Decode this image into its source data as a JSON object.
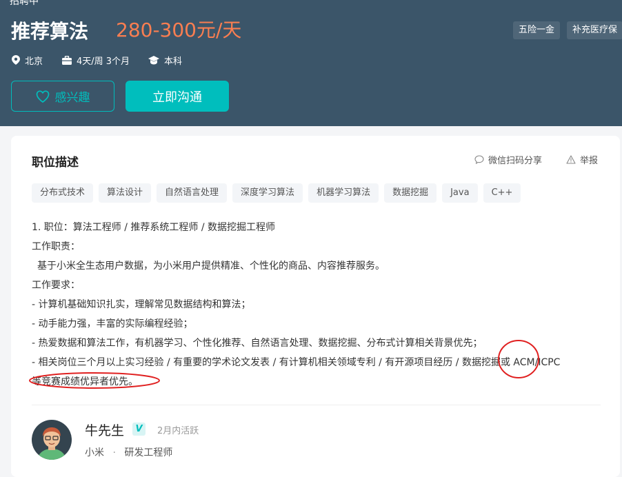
{
  "header": {
    "cut_text": "招聘中",
    "title": "推荐算法",
    "salary": "280-300元/天",
    "benefits": [
      "五险一金",
      "补充医疗保"
    ],
    "meta": {
      "location": "北京",
      "schedule": "4天/周 3个月",
      "degree": "本科"
    },
    "buttons": {
      "like": "感兴趣",
      "chat": "立即沟通"
    }
  },
  "card": {
    "title": "职位描述",
    "share": "微信扫码分享",
    "report": "举报",
    "tags": [
      "分布式技术",
      "算法设计",
      "自然语言处理",
      "深度学习算法",
      "机器学习算法",
      "数据挖掘",
      "Java",
      "C++"
    ],
    "description": [
      "1. 职位：算法工程师 / 推荐系统工程师 / 数据挖掘工程师",
      "工作职责：",
      "基于小米全生态用户数据，为小米用户提供精准、个性化的商品、内容推荐服务。",
      "工作要求：",
      "- 计算机基础知识扎实，理解常见数据结构和算法；",
      "- 动手能力强，丰富的实际编程经验；",
      "- 热爱数据和算法工作，有机器学习、个性化推荐、自然语言处理、数据挖掘、分布式计算相关背景优先；",
      "- 相关岗位三个月以上实习经验 / 有重要的学术论文发表 / 有计算机相关领域专利 / 有开源项目经历 / 数据挖掘或 ACM/ICPC",
      "等竞赛成绩优异者优先。"
    ]
  },
  "recruiter": {
    "name": "牛先生",
    "badge": "V",
    "active": "2月内活跃",
    "company": "小米",
    "separator": "·",
    "position": "研发工程师"
  },
  "colors": {
    "header_bg": "#3b5569",
    "accent": "#00bebd",
    "salary": "#fa7e51",
    "annotation": "#e02020"
  }
}
